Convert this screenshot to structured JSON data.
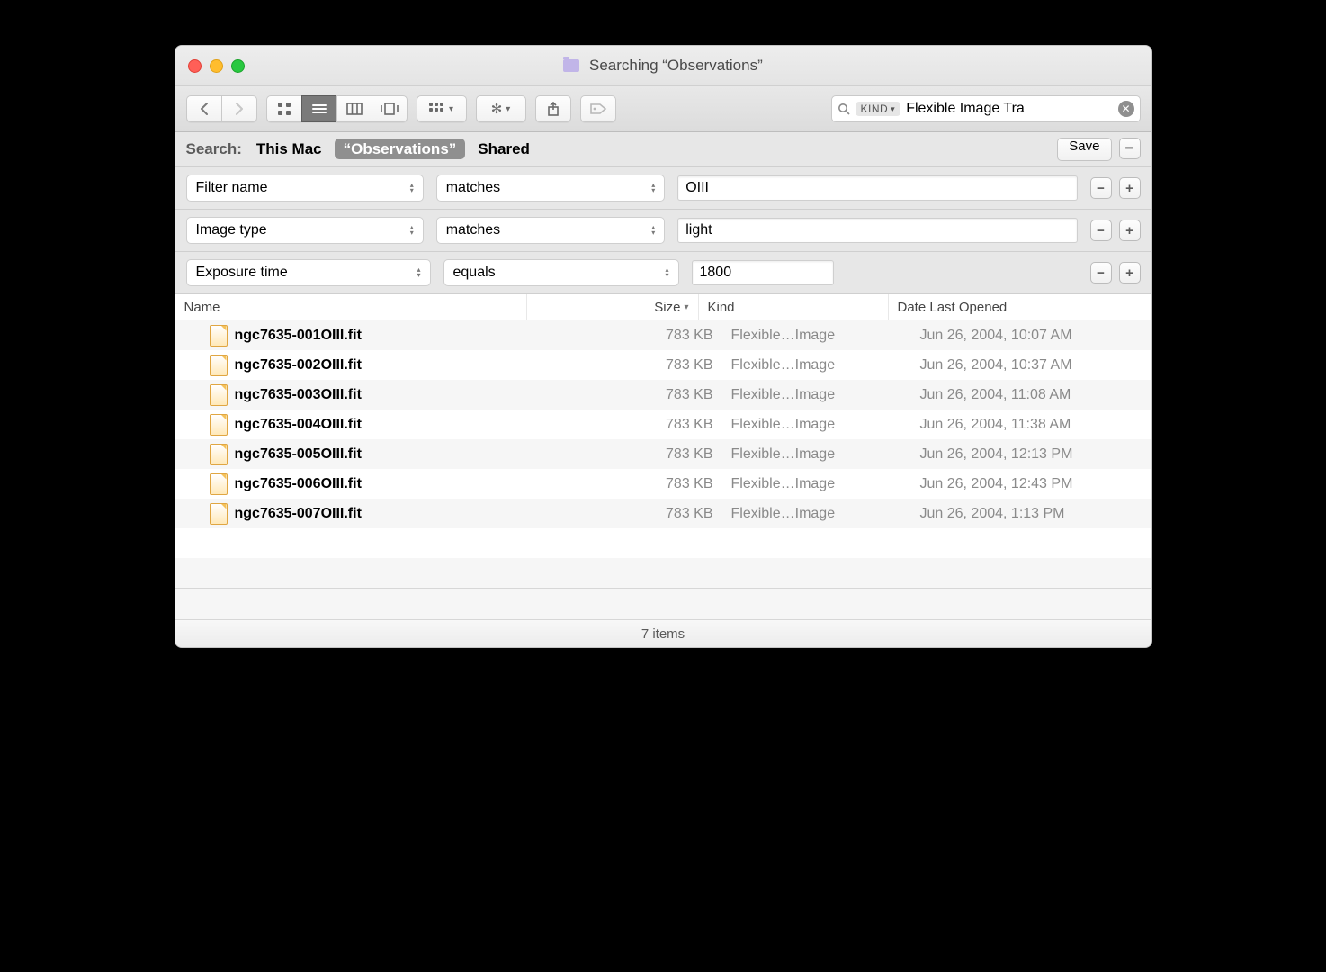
{
  "window_title": "Searching “Observations”",
  "toolbar": {
    "search_kind_token": "KIND",
    "search_text": "Flexible Image Tra"
  },
  "scope": {
    "label": "Search:",
    "items": [
      "This Mac",
      "“Observations”",
      "Shared"
    ],
    "selected_index": 1,
    "save_label": "Save"
  },
  "criteria": [
    {
      "attr": "Filter name",
      "op": "matches",
      "value": "OIII",
      "value_width": 440
    },
    {
      "attr": "Image type",
      "op": "matches",
      "value": "light",
      "value_width": 440
    },
    {
      "attr": "Exposure time",
      "op": "equals",
      "value": "1800",
      "value_width": 140
    }
  ],
  "columns": {
    "name": "Name",
    "size": "Size",
    "kind": "Kind",
    "date": "Date Last Opened"
  },
  "rows": [
    {
      "name": "ngc7635-001OIII.fit",
      "size": "783 KB",
      "kind": "Flexible…Image",
      "date": "Jun 26, 2004, 10:07 AM"
    },
    {
      "name": "ngc7635-002OIII.fit",
      "size": "783 KB",
      "kind": "Flexible…Image",
      "date": "Jun 26, 2004, 10:37 AM"
    },
    {
      "name": "ngc7635-003OIII.fit",
      "size": "783 KB",
      "kind": "Flexible…Image",
      "date": "Jun 26, 2004, 11:08 AM"
    },
    {
      "name": "ngc7635-004OIII.fit",
      "size": "783 KB",
      "kind": "Flexible…Image",
      "date": "Jun 26, 2004, 11:38 AM"
    },
    {
      "name": "ngc7635-005OIII.fit",
      "size": "783 KB",
      "kind": "Flexible…Image",
      "date": "Jun 26, 2004, 12:13 PM"
    },
    {
      "name": "ngc7635-006OIII.fit",
      "size": "783 KB",
      "kind": "Flexible…Image",
      "date": "Jun 26, 2004, 12:43 PM"
    },
    {
      "name": "ngc7635-007OIII.fit",
      "size": "783 KB",
      "kind": "Flexible…Image",
      "date": "Jun 26, 2004, 1:13 PM"
    }
  ],
  "status": "7 items"
}
